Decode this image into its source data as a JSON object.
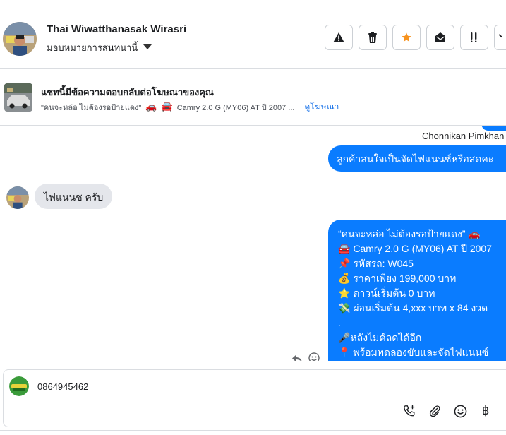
{
  "contact": {
    "name": "Thai Wiwatthanasak Wirasri",
    "assign_label": "มอบหมายการสนทนานี้"
  },
  "actions": [
    {
      "name": "report-icon"
    },
    {
      "name": "trash-icon"
    },
    {
      "name": "star-icon"
    },
    {
      "name": "mark-unread-icon"
    },
    {
      "name": "priority-icon"
    }
  ],
  "ad_reply": {
    "title": "แชทนี้มีข้อความตอบกลับต่อโฆษณาของคุณ",
    "snippet_quote": "\"คนจะหล่อ ไม่ต้องรอป้ายแดง\"",
    "snippet_car": "Camry 2.0 G (MY06) AT ปี 2007 ...",
    "view_ad": "ดูโฆษณา"
  },
  "messages": {
    "outgoing_sender": "Chonnikan Pimkhan",
    "outgoing_1": "ลูกค้าสนใจเป็นจัดไฟแนนซ์หรือสดคะ",
    "incoming_1": "ไฟแนนซ ครับ",
    "outgoing_2": [
      "“คนจะหล่อ ไม่ต้องรอป้ายแดง” 🚗",
      "🚘 Camry 2.0 G (MY06) AT ปี 2007",
      "📌 รหัสรถ: W045",
      "💰 ราคาเพียง 199,000 บาท",
      "⭐ ดาวน์เริ่มต้น 0 บาท",
      "💸 ผ่อนเริ่มต้น 4,xxx บาท x 84 งวด",
      ".",
      "🎤หลังไมค์ลดได้อีก",
      "📍 พร้อมทดลองขับและจัดไฟแนนซ์"
    ]
  },
  "composer": {
    "value": "0864945462",
    "baht_symbol": "฿"
  },
  "colors": {
    "accent": "#0a7cff",
    "star": "#f7931e",
    "incoming_bg": "#e4e6eb"
  }
}
